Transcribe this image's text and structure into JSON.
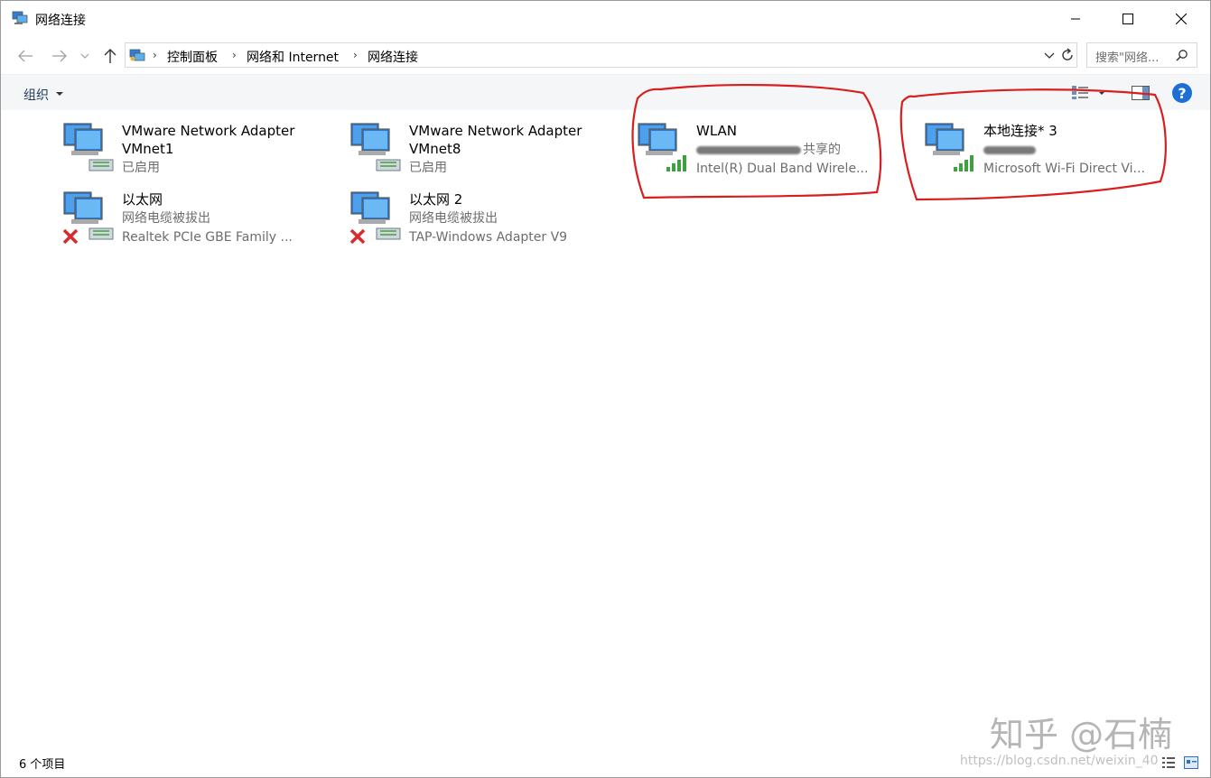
{
  "window": {
    "title": "网络连接"
  },
  "nav": {
    "breadcrumbs": [
      "控制面板",
      "网络和 Internet",
      "网络连接"
    ],
    "search_placeholder": "搜索\"网络..."
  },
  "toolbar": {
    "organize_label": "组织",
    "help_label": "?"
  },
  "items": [
    {
      "name": "VMware Network Adapter",
      "name2": "VMnet1",
      "status": "已启用",
      "device": "",
      "icon": "network-adapter-icon",
      "state": "enabled"
    },
    {
      "name": "VMware Network Adapter",
      "name2": "VMnet8",
      "status": "已启用",
      "device": "",
      "icon": "network-adapter-icon",
      "state": "enabled"
    },
    {
      "name": "WLAN",
      "name2": "",
      "status": "共享的",
      "device": "Intel(R) Dual Band Wirele...",
      "icon": "wifi-adapter-icon",
      "state": "wifi"
    },
    {
      "name": "本地连接* 3",
      "name2": "",
      "status": "",
      "device": "Microsoft Wi-Fi Direct Vi...",
      "icon": "wifi-adapter-icon",
      "state": "wifi"
    },
    {
      "name": "以太网",
      "name2": "",
      "status": "网络电缆被拔出",
      "device": "Realtek PCIe GBE Family ...",
      "icon": "ethernet-adapter-icon",
      "state": "unplugged"
    },
    {
      "name": "以太网 2",
      "name2": "",
      "status": "网络电缆被拔出",
      "device": "TAP-Windows Adapter V9",
      "icon": "ethernet-adapter-icon",
      "state": "unplugged"
    }
  ],
  "status": {
    "item_count": "6 个项目"
  },
  "watermark": {
    "text": "知乎 @石楠",
    "url": "https://blog.csdn.net/weixin_40"
  },
  "colors": {
    "accent": "#1e6fd4",
    "annotation": "#d81e1e",
    "signal": "#3ea13e",
    "error": "#d92b2b"
  }
}
